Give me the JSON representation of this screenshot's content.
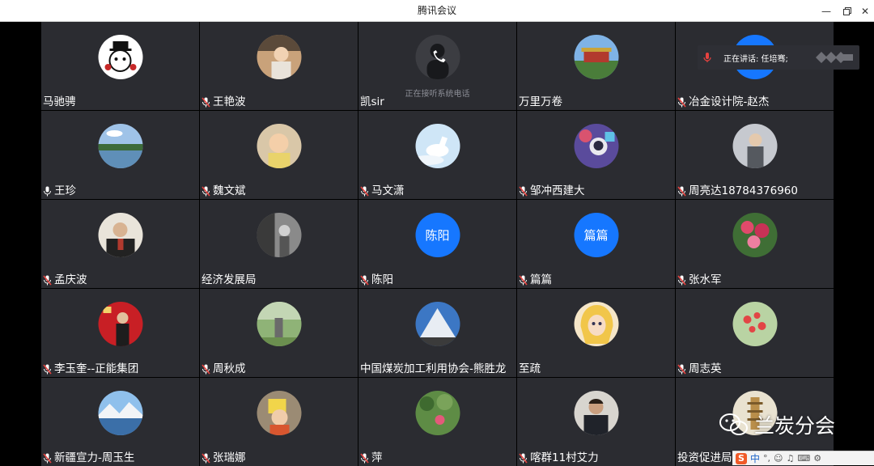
{
  "window": {
    "title": "腾讯会议"
  },
  "speaking": {
    "label": "正在讲话: 任培骞;"
  },
  "watermark": {
    "text": "兰炭分会"
  },
  "ime": {
    "logo": "S",
    "mode": "中"
  },
  "colors": {
    "tile_bg": "#2b2c31",
    "accent_blue": "#1677ff",
    "mic_muted": "#e7423f"
  },
  "participants": [
    {
      "name": "马驰骋",
      "mic": "none",
      "avatar": "cartoon-bear"
    },
    {
      "name": "王艳波",
      "mic": "muted",
      "avatar": "photo-portrait"
    },
    {
      "name": "凯sir",
      "mic": "none",
      "avatar": "phone-call",
      "note": "正在接听系统电话"
    },
    {
      "name": "万里万卷",
      "mic": "none",
      "avatar": "photo-gate"
    },
    {
      "name": "冶金设计院-赵杰",
      "mic": "muted",
      "avatar": "initials-blue",
      "initials": ""
    },
    {
      "name": "王珍",
      "mic": "on",
      "avatar": "photo-lake"
    },
    {
      "name": "魏文斌",
      "mic": "muted",
      "avatar": "photo-baby"
    },
    {
      "name": "马文潇",
      "mic": "muted",
      "avatar": "photo-horse"
    },
    {
      "name": "邹冲西建大",
      "mic": "muted",
      "avatar": "photo-astronaut"
    },
    {
      "name": "周亮达18784376960",
      "mic": "muted",
      "avatar": "photo-person"
    },
    {
      "name": "孟庆波",
      "mic": "muted",
      "avatar": "photo-man"
    },
    {
      "name": "经济发展局",
      "mic": "none",
      "avatar": "photo-bw"
    },
    {
      "name": "陈阳",
      "mic": "muted",
      "avatar": "initials-blue",
      "initials": "陈阳"
    },
    {
      "name": "篇篇",
      "mic": "muted",
      "avatar": "initials-blue",
      "initials": "篇篇"
    },
    {
      "name": "张水军",
      "mic": "muted",
      "avatar": "photo-flowers"
    },
    {
      "name": "李玉奎--正能集团",
      "mic": "muted",
      "avatar": "photo-stage"
    },
    {
      "name": "周秋成",
      "mic": "muted",
      "avatar": "photo-garden"
    },
    {
      "name": "中国煤炭加工利用协会-熊胜龙",
      "mic": "none",
      "avatar": "photo-snowtree"
    },
    {
      "name": "至疏",
      "mic": "none",
      "avatar": "cartoon-girl"
    },
    {
      "name": "周志英",
      "mic": "muted",
      "avatar": "photo-blossom"
    },
    {
      "name": "新疆宣力-周玉生",
      "mic": "muted",
      "avatar": "photo-mountain"
    },
    {
      "name": "张瑞娜",
      "mic": "muted",
      "avatar": "photo-child"
    },
    {
      "name": "萍",
      "mic": "muted",
      "avatar": "photo-park"
    },
    {
      "name": "喀群11村艾力",
      "mic": "muted",
      "avatar": "photo-guy"
    },
    {
      "name": "投资促进局才",
      "mic": "none",
      "avatar": "photo-pagoda"
    }
  ]
}
